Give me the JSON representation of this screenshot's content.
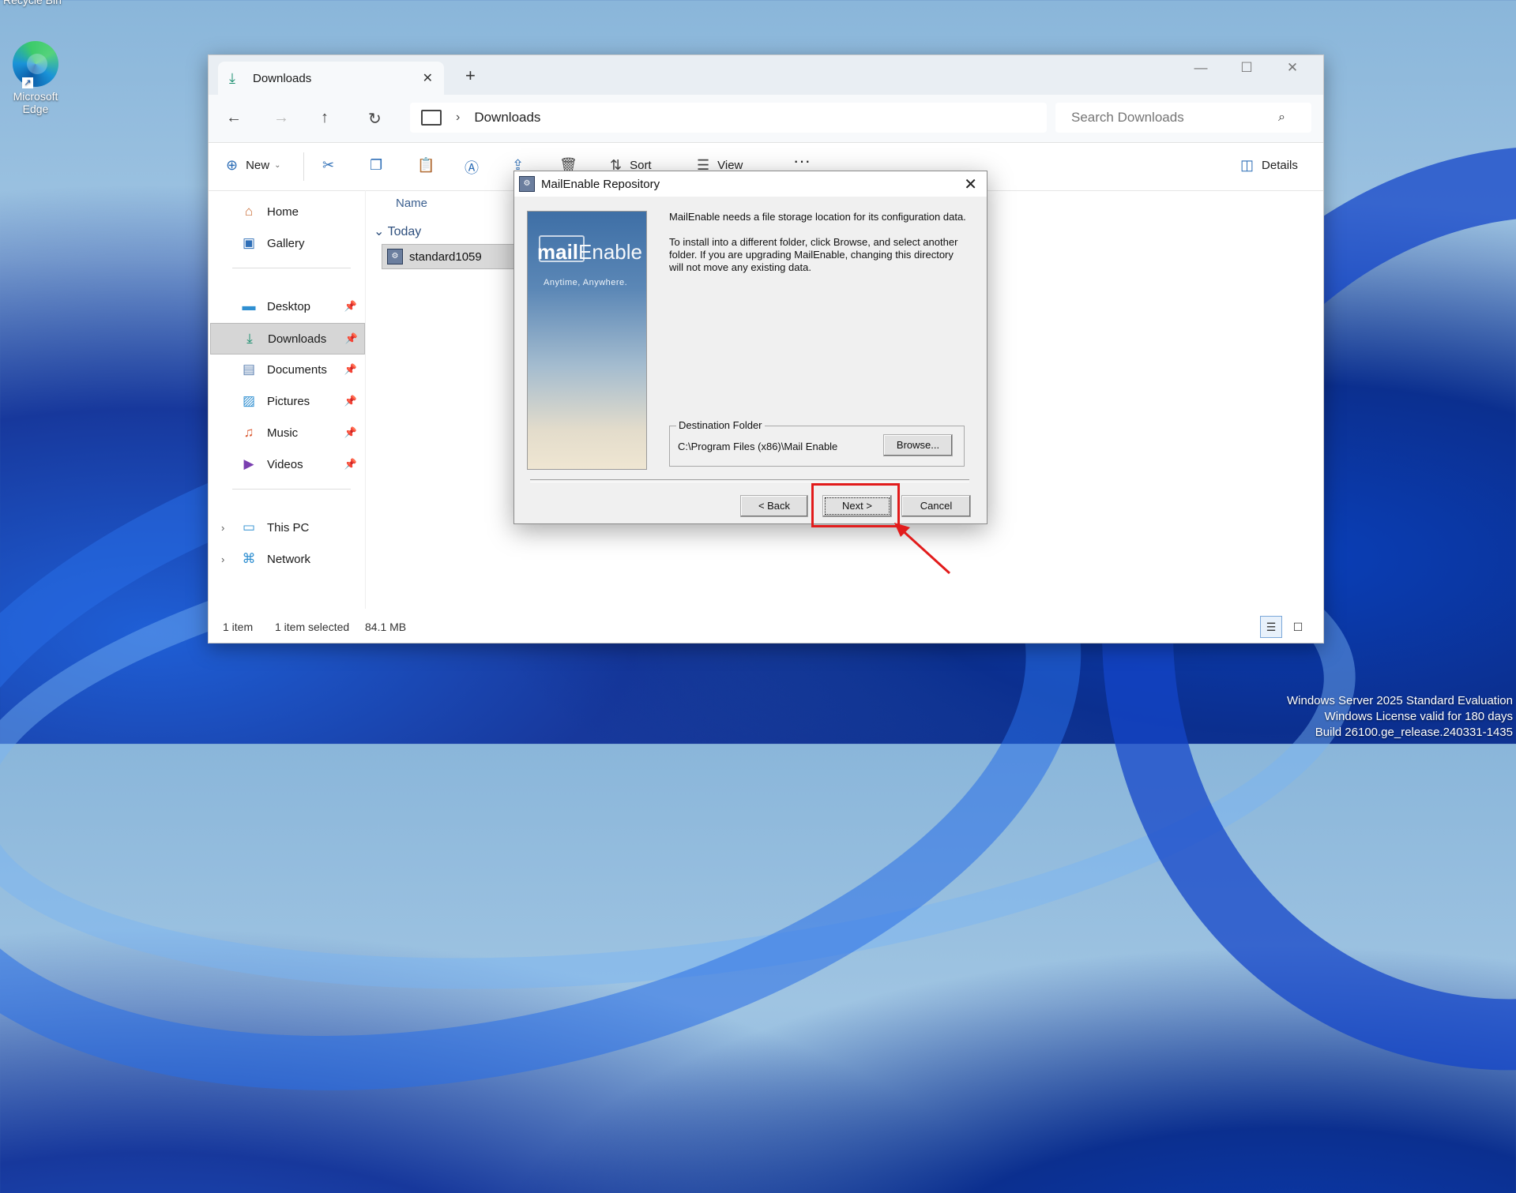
{
  "desktop": {
    "recycle_bin_label": "Recycle Bin",
    "edge_label_line1": "Microsoft",
    "edge_label_line2": "Edge",
    "watermark_line1": "Windows Server 2025 Standard Evaluation",
    "watermark_line2": "Windows License valid for 180 days",
    "watermark_line3": "Build 26100.ge_release.240331-1435"
  },
  "explorer": {
    "tab_label": "Downloads",
    "breadcrumb": "Downloads",
    "search_placeholder": "Search Downloads",
    "toolbar": {
      "new_label": "New",
      "sort_label": "Sort",
      "view_label": "View",
      "details_label": "Details"
    },
    "sidebar": {
      "quick": [
        {
          "label": "Home",
          "icon": "home-icon"
        },
        {
          "label": "Gallery",
          "icon": "gallery-icon"
        }
      ],
      "pinned": [
        {
          "label": "Desktop",
          "icon": "desktop-icon"
        },
        {
          "label": "Downloads",
          "icon": "download-icon"
        },
        {
          "label": "Documents",
          "icon": "documents-icon"
        },
        {
          "label": "Pictures",
          "icon": "pictures-icon"
        },
        {
          "label": "Music",
          "icon": "music-icon"
        },
        {
          "label": "Videos",
          "icon": "videos-icon"
        }
      ],
      "tree": [
        {
          "label": "This PC",
          "icon": "computer-icon"
        },
        {
          "label": "Network",
          "icon": "network-icon"
        }
      ]
    },
    "content": {
      "column_name": "Name",
      "group_label": "Today",
      "file_name": "standard1059"
    },
    "status": {
      "count": "1 item",
      "selection": "1 item selected",
      "size": "84.1 MB"
    }
  },
  "dialog": {
    "title": "MailEnable Repository",
    "brand_bold": "mail",
    "brand_light": "Enable",
    "tagline": "Anytime, Anywhere.",
    "paragraph1": "MailEnable needs a file storage location for its configuration data.",
    "paragraph2": "To install into a different folder, click Browse, and select another folder. If you are upgrading MailEnable, changing this directory will not move any existing data.",
    "group_label": "Destination Folder",
    "destination_path": "C:\\Program Files (x86)\\Mail Enable",
    "browse_label": "Browse...",
    "back_label": "< Back",
    "next_label": "Next >",
    "cancel_label": "Cancel"
  },
  "colors": {
    "highlight": "#e21b1b",
    "accent": "#2f6fb7"
  }
}
